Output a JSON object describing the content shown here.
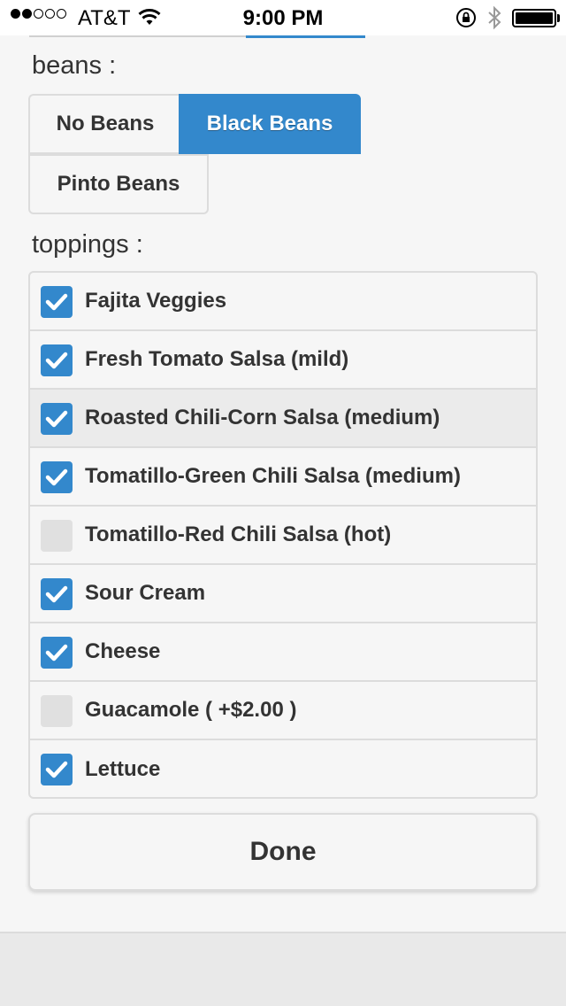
{
  "status_bar": {
    "carrier": "AT&T",
    "time": "9:00 PM",
    "signal_bars_filled": 2,
    "signal_bars_total": 5,
    "icons": [
      "wifi-icon",
      "orientation-lock-icon",
      "bluetooth-icon",
      "battery-icon"
    ]
  },
  "beans": {
    "label": "beans :",
    "options": [
      {
        "label": "No Beans",
        "selected": false
      },
      {
        "label": "Black Beans",
        "selected": true
      },
      {
        "label": "Pinto Beans",
        "selected": false
      }
    ]
  },
  "toppings": {
    "label": "toppings :",
    "items": [
      {
        "label": "Fajita Veggies",
        "checked": true
      },
      {
        "label": "Fresh Tomato Salsa (mild)",
        "checked": true
      },
      {
        "label": "Roasted Chili-Corn Salsa (medium)",
        "checked": true
      },
      {
        "label": "Tomatillo-Green Chili Salsa (medium)",
        "checked": true
      },
      {
        "label": "Tomatillo-Red Chili Salsa (hot)",
        "checked": false
      },
      {
        "label": "Sour Cream",
        "checked": true
      },
      {
        "label": "Cheese",
        "checked": true
      },
      {
        "label": "Guacamole ( +$2.00 )",
        "checked": false
      },
      {
        "label": "Lettuce",
        "checked": true
      }
    ]
  },
  "done_label": "Done",
  "colors": {
    "accent": "#3388cc",
    "panel": "#f6f6f6",
    "border": "#dcdcdc",
    "text": "#333333"
  }
}
